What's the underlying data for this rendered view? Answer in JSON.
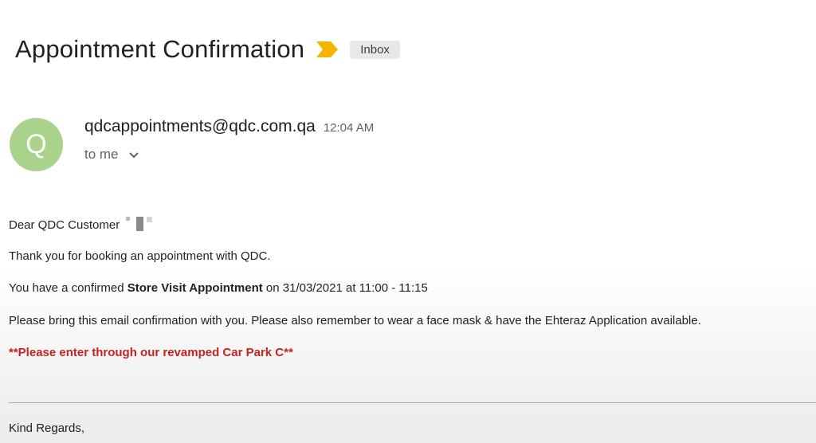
{
  "email": {
    "subject": "Appointment Confirmation",
    "label": "Inbox",
    "sender": {
      "avatar_letter": "Q",
      "email": "qdcappointments@qdc.com.qa",
      "time": "12:04 AM",
      "recipient": "to me"
    },
    "body": {
      "greeting": "Dear QDC Customer",
      "thanks": "Thank you for booking an appointment with QDC.",
      "confirm_prefix": "You have a confirmed ",
      "appointment_type": "Store Visit Appointment",
      "confirm_suffix": " on 31/03/2021 at 11:00 - 11:15",
      "reminder": "Please bring this email confirmation with you. Please also remember to wear a face mask & have the Ehteraz Application available.",
      "notice": "**Please enter through our revamped Car Park C**",
      "closing": "Kind Regards,"
    }
  },
  "icons": {
    "importance": "importance-marker-icon",
    "expand": "chevron-down-icon"
  },
  "colors": {
    "avatar": "#a9d38b",
    "importance": "#f4b400",
    "notice": "#c5221f",
    "label_chip": "#e8e8e8"
  }
}
